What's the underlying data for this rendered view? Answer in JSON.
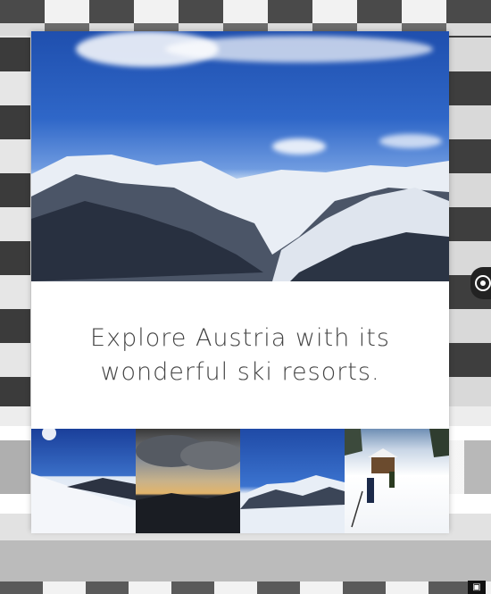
{
  "card": {
    "caption": "Explore Austria with its wonderful ski resorts.",
    "hero_image": "mountain-panorama-image",
    "thumbnails": [
      {
        "name": "ski-slope-sun-image"
      },
      {
        "name": "sunset-clouds-image"
      },
      {
        "name": "snowy-peaks-image"
      },
      {
        "name": "skiers-hut-image"
      }
    ]
  },
  "controls": {
    "side_handle_icon": "circle-dot-icon",
    "corner_icon": "fullscreen-icon"
  },
  "colors": {
    "card_background": "#ffffff",
    "caption_text": "#444444",
    "sky_blue": "#2f67c8"
  }
}
